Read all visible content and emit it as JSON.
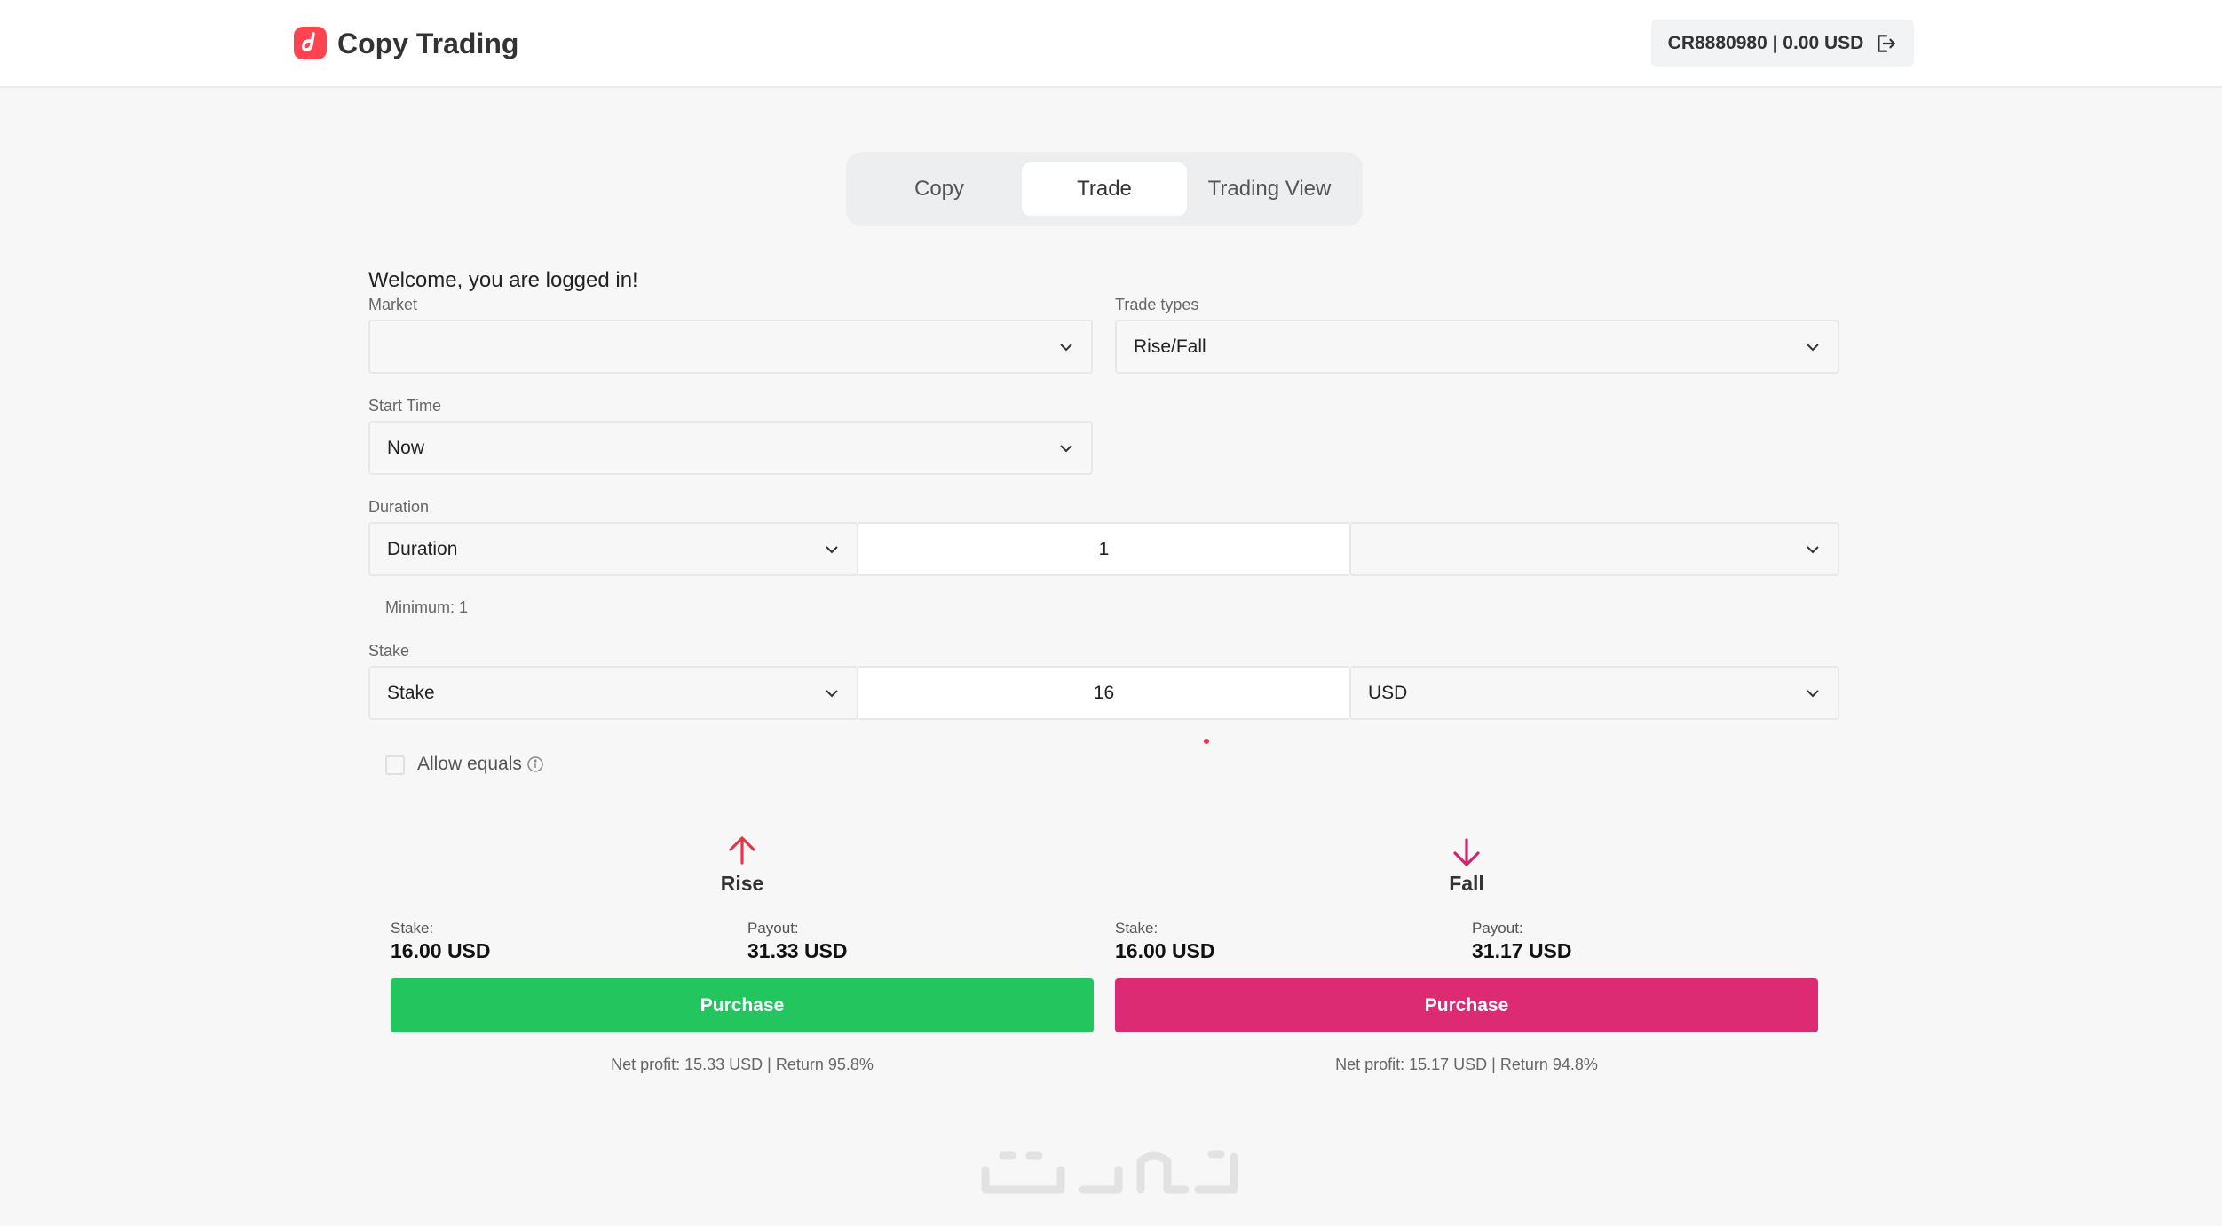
{
  "header": {
    "title": "Copy Trading",
    "account": "CR8880980 | 0.00 USD",
    "logo_icon": "deriv-logo-icon",
    "logout_icon": "logout-icon"
  },
  "tabs": [
    {
      "label": "Copy",
      "active": false
    },
    {
      "label": "Trade",
      "active": true
    },
    {
      "label": "Trading View",
      "active": false
    }
  ],
  "form": {
    "welcome": "Welcome, you are logged in!",
    "market": {
      "label": "Market",
      "value": ""
    },
    "trade_types": {
      "label": "Trade types",
      "value": "Rise/Fall"
    },
    "start_time": {
      "label": "Start Time",
      "value": "Now"
    },
    "duration": {
      "label": "Duration",
      "type": "Duration",
      "value": "1",
      "unit": "",
      "minimum": "Minimum: 1"
    },
    "stake": {
      "label": "Stake",
      "type": "Stake",
      "value": "16",
      "currency": "USD"
    },
    "allow_equals": {
      "label": "Allow equals",
      "checked": false
    }
  },
  "contracts": {
    "rise": {
      "label": "Rise",
      "stake_label": "Stake:",
      "stake": "16.00 USD",
      "payout_label": "Payout:",
      "payout": "31.33 USD",
      "button": "Purchase",
      "net": "Net profit: 15.33 USD | Return 95.8%",
      "color": "#22c55e",
      "arrow_color": "#e5374a"
    },
    "fall": {
      "label": "Fall",
      "stake_label": "Stake:",
      "stake": "16.00 USD",
      "payout_label": "Payout:",
      "payout": "31.17 USD",
      "button": "Purchase",
      "net": "Net profit: 15.17 USD | Return 94.8%",
      "color": "#dc2a73",
      "arrow_color": "#d0246e"
    }
  },
  "watermark": "خمسات"
}
